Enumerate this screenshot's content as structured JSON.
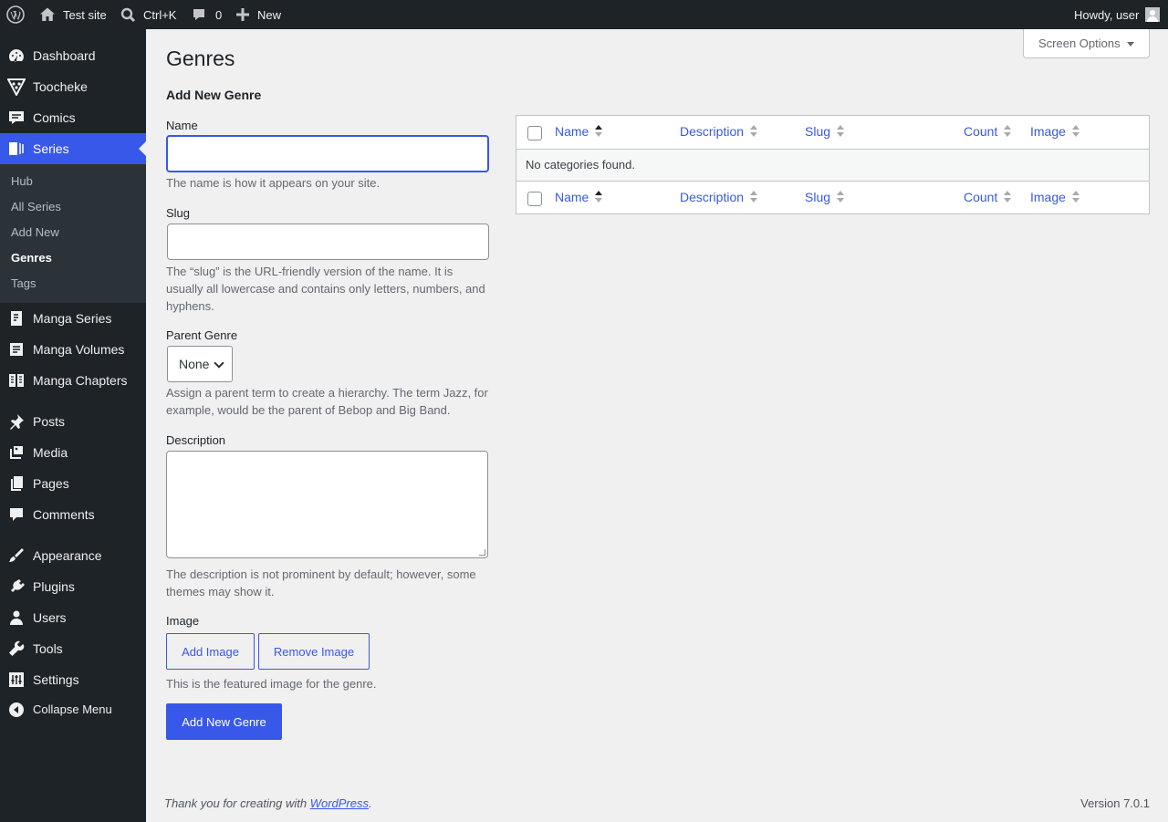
{
  "adminbar": {
    "site_name": "Test site",
    "search_shortcut": "Ctrl+K",
    "comments_count": "0",
    "new_label": "New",
    "howdy": "Howdy, user"
  },
  "sidebar": {
    "items": [
      {
        "label": "Dashboard",
        "icon": "dashboard-icon"
      },
      {
        "label": "Toocheke",
        "icon": "toocheke-icon"
      },
      {
        "label": "Comics",
        "icon": "comics-icon"
      },
      {
        "label": "Series",
        "icon": "series-icon"
      },
      {
        "label": "Manga Series",
        "icon": "manga-series-icon"
      },
      {
        "label": "Manga Volumes",
        "icon": "manga-volumes-icon"
      },
      {
        "label": "Manga Chapters",
        "icon": "manga-chapters-icon"
      },
      {
        "label": "Posts",
        "icon": "pin-icon"
      },
      {
        "label": "Media",
        "icon": "media-icon"
      },
      {
        "label": "Pages",
        "icon": "pages-icon"
      },
      {
        "label": "Comments",
        "icon": "comment-icon"
      },
      {
        "label": "Appearance",
        "icon": "brush-icon"
      },
      {
        "label": "Plugins",
        "icon": "plugin-icon"
      },
      {
        "label": "Users",
        "icon": "user-icon"
      },
      {
        "label": "Tools",
        "icon": "wrench-icon"
      },
      {
        "label": "Settings",
        "icon": "settings-icon"
      },
      {
        "label": "Collapse Menu",
        "icon": "collapse-icon"
      }
    ],
    "submenu": [
      "Hub",
      "All Series",
      "Add New",
      "Genres",
      "Tags"
    ]
  },
  "screen_options": "Screen Options",
  "page_title": "Genres",
  "form": {
    "heading": "Add New Genre",
    "name_label": "Name",
    "name_value": "",
    "name_help": "The name is how it appears on your site.",
    "slug_label": "Slug",
    "slug_value": "",
    "slug_help": "The “slug” is the URL-friendly version of the name. It is usually all lowercase and contains only letters, numbers, and hyphens.",
    "parent_label": "Parent Genre",
    "parent_value": "None",
    "parent_help": "Assign a parent term to create a hierarchy. The term Jazz, for example, would be the parent of Bebop and Big Band.",
    "description_label": "Description",
    "description_value": "",
    "description_help": "The description is not prominent by default; however, some themes may show it.",
    "image_label": "Image",
    "add_image": "Add Image",
    "remove_image": "Remove Image",
    "image_help": "This is the featured image for the genre.",
    "submit": "Add New Genre"
  },
  "table": {
    "columns": [
      "Name",
      "Description",
      "Slug",
      "Count",
      "Image"
    ],
    "empty_message": "No categories found."
  },
  "footer": {
    "thanks_prefix": "Thank you for creating with ",
    "wordpress_link": "WordPress",
    "thanks_suffix": ".",
    "version": "Version 7.0.1"
  }
}
